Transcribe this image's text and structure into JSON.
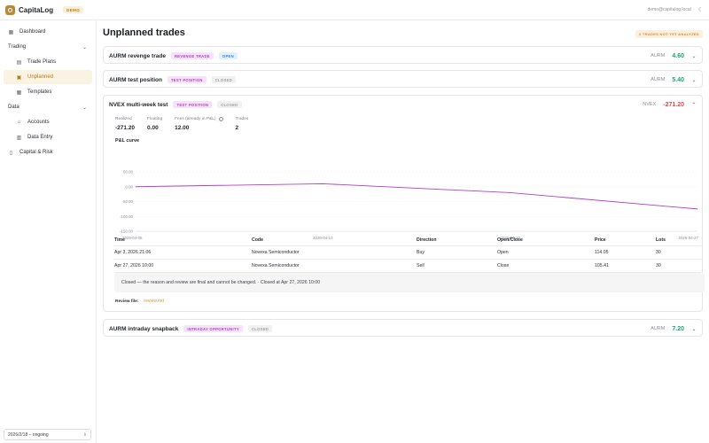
{
  "app": {
    "brand": "CapitaLog",
    "demo_label": "DEMO",
    "user_email": "demo@capitalog.local",
    "theme_icon": "moon-icon"
  },
  "sidebar": {
    "items": [
      {
        "label": "Dashboard",
        "icon": "dashboard-icon"
      },
      {
        "label": "Trading",
        "icon": "",
        "chevron": "chevron-down-icon"
      },
      {
        "label": "Trade Plans",
        "icon": "clipboard-icon"
      },
      {
        "label": "Unplanned",
        "icon": "clipboard-check-icon",
        "active": true
      },
      {
        "label": "Templates",
        "icon": "grid-icon"
      },
      {
        "label": "Data",
        "icon": "",
        "chevron": "chevron-down-icon"
      },
      {
        "label": "Accounts",
        "icon": "bank-icon"
      },
      {
        "label": "Data Entry",
        "icon": "calendar-icon"
      },
      {
        "label": "Capital & Risk",
        "icon": "document-icon"
      }
    ],
    "period": "2026/2/18 – ongoing"
  },
  "page": {
    "title": "Unplanned trades",
    "warning": "2 TRADES NOT YET ANALYZED"
  },
  "cards": [
    {
      "title": "AURM revenge trade",
      "tags": [
        "REVENGE TRADE",
        "OPEN"
      ],
      "symbol": "AURM",
      "pnl": "4.60"
    },
    {
      "title": "AURM test position",
      "tags": [
        "TEST POSITION",
        "CLOSED"
      ],
      "symbol": "AURM",
      "pnl": "5.40"
    },
    {
      "title": "NVEX multi-week test",
      "tags": [
        "TEST POSITION",
        "CLOSED"
      ],
      "symbol": "NVEX",
      "pnl": "-271.20",
      "stats": [
        {
          "label": "Realized",
          "value": "-271.20"
        },
        {
          "label": "Floating",
          "value": "0.00"
        },
        {
          "label": "Fees (already in P&L)",
          "value": "12.00"
        },
        {
          "label": "Trades",
          "value": "2"
        }
      ],
      "chart_label": "P&L curve",
      "table": {
        "headers": [
          "Time",
          "Code",
          "Direction",
          "Open/Close",
          "Price",
          "Lots"
        ],
        "rows": [
          [
            "Apr 3, 2026 21:06",
            "Novexa Semiconductor",
            "Buy",
            "Open",
            "114.05",
            "30"
          ],
          [
            "Apr 27, 2026 10:00",
            "Novexa Semiconductor",
            "Sell",
            "Close",
            "105.41",
            "30"
          ]
        ]
      },
      "closed_note": "Closed — the reason and review are final and cannot be changed. · Closed at Apr 27, 2026 10:00",
      "review_label": "Review file:",
      "review_file": "review.md"
    },
    {
      "title": "AURM intraday snapback",
      "tags": [
        "INTRADAY OPPORTUNITY",
        "CLOSED"
      ],
      "symbol": "AURM",
      "pnl": "7.20"
    }
  ],
  "chart_data": {
    "type": "line",
    "title": "P&L curve",
    "xlabel": "",
    "ylabel": "",
    "x_ticks": [
      "2026-04-05",
      "2026-04-13",
      "2026-04-20",
      "2026-04-27"
    ],
    "y_ticks": [
      "50.00",
      "0.00",
      "-50.00",
      "-100.00",
      "-150.00"
    ],
    "ylim": [
      -150,
      50
    ],
    "x": [
      "2026-04-05",
      "2026-04-13",
      "2026-04-20",
      "2026-04-27"
    ],
    "series": [
      {
        "values": [
          0,
          10,
          -20,
          -75
        ]
      }
    ],
    "color": "#b23fc9",
    "grid": true
  }
}
